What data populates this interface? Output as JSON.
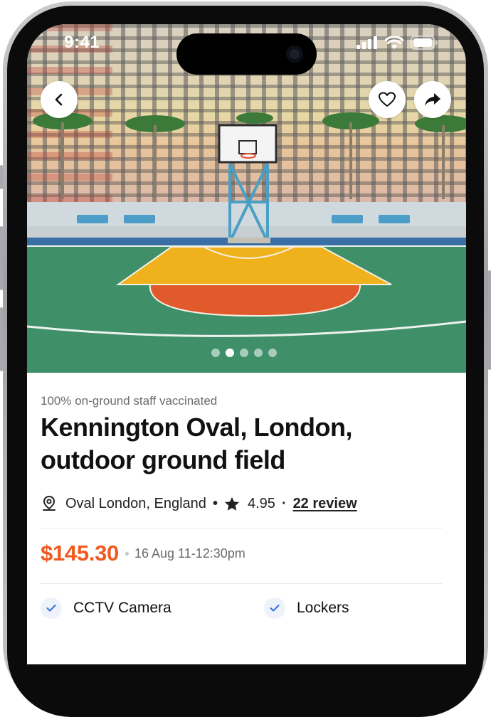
{
  "status_bar": {
    "time": "9:41"
  },
  "hero": {
    "carousel": {
      "count": 5,
      "active_index": 1
    },
    "buttons": {
      "back_icon": "chevron-left-icon",
      "favorite_icon": "heart-icon",
      "share_icon": "share-arrow-icon"
    }
  },
  "listing": {
    "notice": "100% on-ground staff vaccinated",
    "title": "Kennington Oval, London, outdoor ground field",
    "location": "Oval London, England",
    "rating": "4.95",
    "reviews": "22 review",
    "price": "$145.30",
    "datetime": "16 Aug 11-12:30pm",
    "amenities": [
      {
        "label": "CCTV Camera",
        "icon": "check-icon"
      },
      {
        "label": "Lockers",
        "icon": "check-icon"
      }
    ]
  },
  "colors": {
    "accent": "#f05a22",
    "check": "#2f6fe0",
    "check_bg": "#eef3fb"
  }
}
